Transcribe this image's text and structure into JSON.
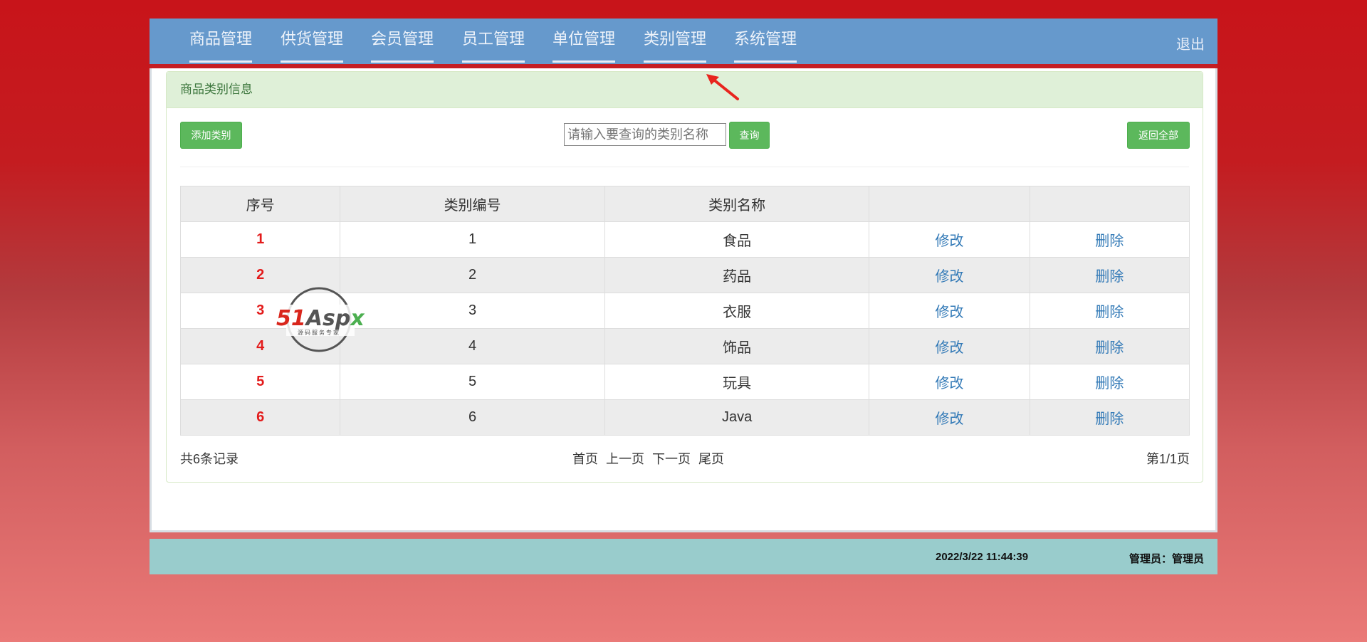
{
  "nav": {
    "items": [
      "商品管理",
      "供货管理",
      "会员管理",
      "员工管理",
      "单位管理",
      "类别管理",
      "系统管理"
    ],
    "logout": "退出"
  },
  "panel": {
    "heading": "商品类别信息",
    "add_button": "添加类别",
    "search_placeholder": "请输入要查询的类别名称",
    "search_button": "查询",
    "reset_button": "返回全部"
  },
  "table": {
    "headers": [
      "序号",
      "类别编号",
      "类别名称",
      "",
      ""
    ],
    "rows": [
      {
        "index": "1",
        "id": "1",
        "name": "食品",
        "edit": "修改",
        "delete": "删除"
      },
      {
        "index": "2",
        "id": "2",
        "name": "药品",
        "edit": "修改",
        "delete": "删除"
      },
      {
        "index": "3",
        "id": "3",
        "name": "衣服",
        "edit": "修改",
        "delete": "删除"
      },
      {
        "index": "4",
        "id": "4",
        "name": "饰品",
        "edit": "修改",
        "delete": "删除"
      },
      {
        "index": "5",
        "id": "5",
        "name": "玩具",
        "edit": "修改",
        "delete": "删除"
      },
      {
        "index": "6",
        "id": "6",
        "name": "Java",
        "edit": "修改",
        "delete": "删除"
      }
    ]
  },
  "pager": {
    "count": "共6条记录",
    "first": "首页",
    "prev": "上一页",
    "next": "下一页",
    "last": "尾页",
    "page_info": "第1/1页"
  },
  "status": {
    "datetime": "2022/3/22 11:44:39",
    "user": "管理员：管理员"
  },
  "watermark": {
    "brand": "51Aspx",
    "tagline": "源码服务专家"
  },
  "colors": {
    "nav_bg": "#6699cc",
    "accent_red": "#c51e23",
    "button_green": "#5cb85c",
    "link_blue": "#337ab7",
    "status_bar": "#99cccc"
  }
}
